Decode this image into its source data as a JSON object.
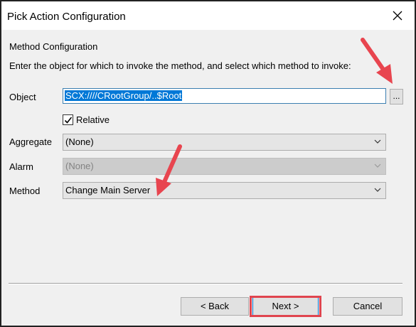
{
  "window": {
    "title": "Pick Action Configuration",
    "close_glyph": "✕"
  },
  "section": {
    "title": "Method Configuration",
    "description": "Enter the object for which to invoke the method, and select which method to invoke:"
  },
  "object_field": {
    "label": "Object",
    "value": "SCX:////CRootGroup/..$Root",
    "browse_label": "..."
  },
  "relative": {
    "label": "Relative",
    "checked": true
  },
  "aggregate": {
    "label": "Aggregate",
    "value": "(None)"
  },
  "alarm": {
    "label": "Alarm",
    "value": "(None)",
    "disabled": true
  },
  "method": {
    "label": "Method",
    "value": "Change Main Server"
  },
  "buttons": {
    "back": "< Back",
    "next": "Next >",
    "cancel": "Cancel"
  },
  "annotations": {
    "arrow_color": "#e8454f",
    "highlight_color": "#e0454f"
  },
  "icons": [
    "close-icon",
    "checkmark-icon",
    "chevron-down-icon",
    "annotation-arrow-icon"
  ]
}
